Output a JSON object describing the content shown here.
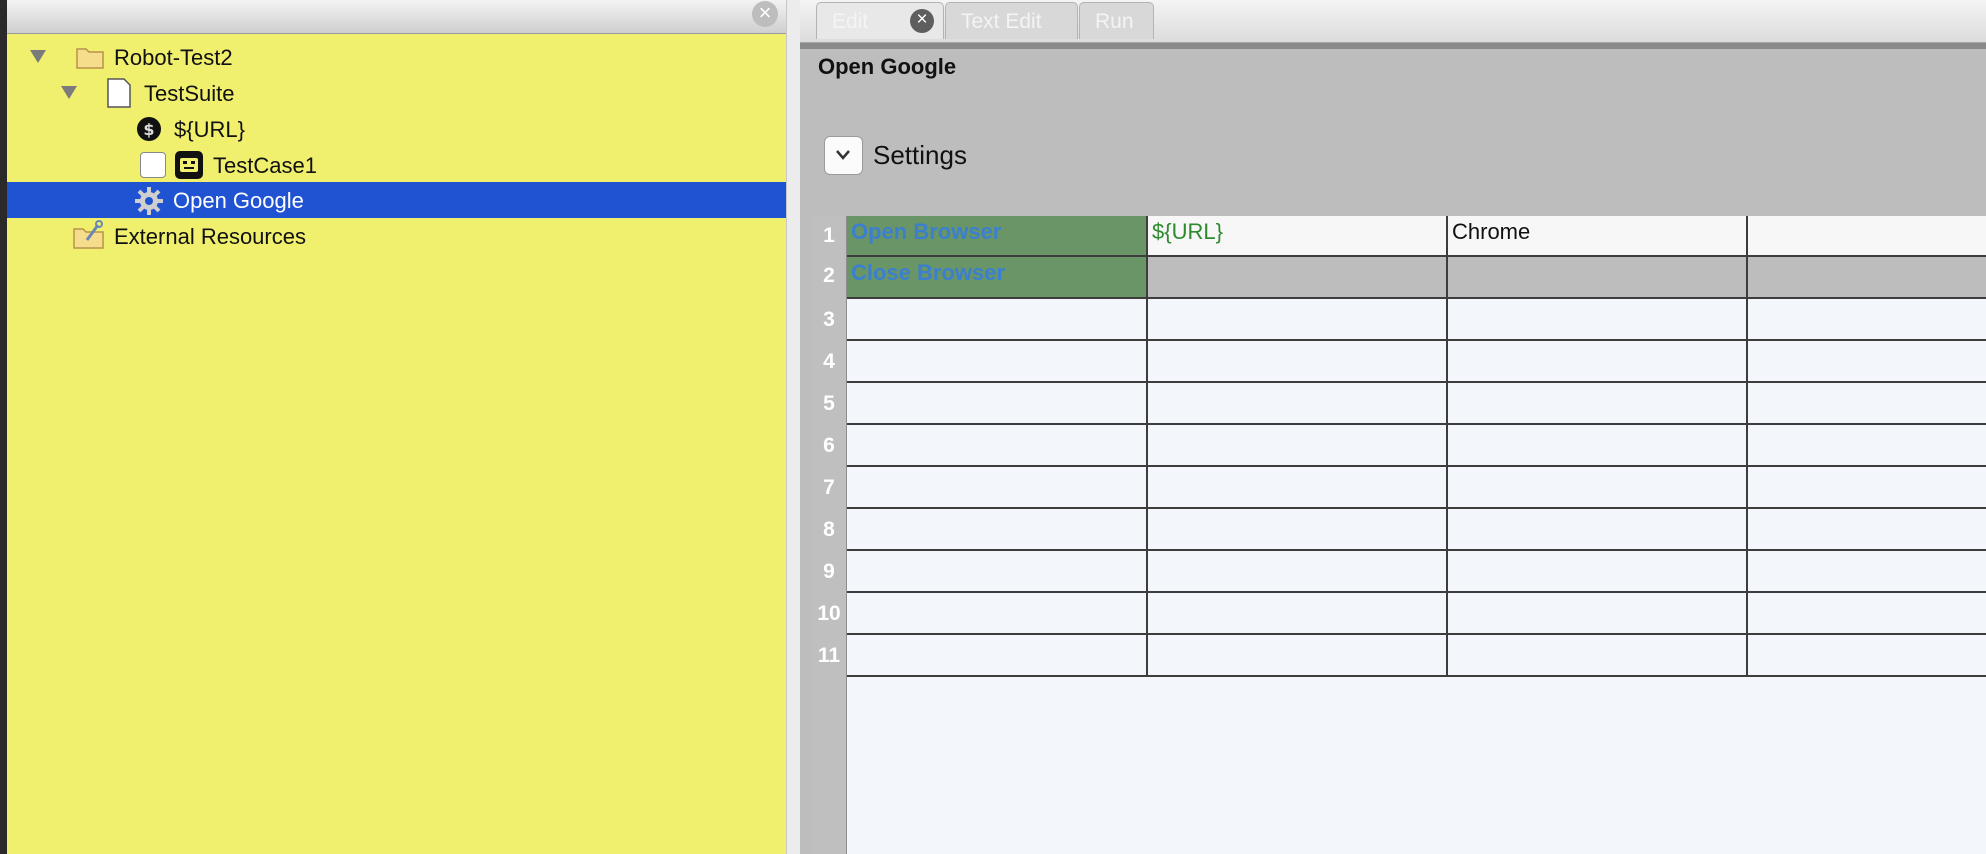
{
  "tree": {
    "items": [
      {
        "label": "Robot-Test2",
        "icon": "folder-icon"
      },
      {
        "label": "TestSuite",
        "icon": "file-icon"
      },
      {
        "label": "${URL}",
        "icon": "variable-icon"
      },
      {
        "label": "TestCase1",
        "icon": "robot-icon"
      },
      {
        "label": "Open Google",
        "icon": "gear-icon"
      },
      {
        "label": "External Resources",
        "icon": "resource-folder-icon"
      }
    ],
    "selected": "Open Google"
  },
  "tabs": [
    {
      "label": "Edit"
    },
    {
      "label": "Text Edit"
    },
    {
      "label": "Run"
    }
  ],
  "editor": {
    "title": "Open Google",
    "settings_label": "Settings"
  },
  "grid": {
    "row_numbers": [
      "1",
      "2",
      "3",
      "4",
      "5",
      "6",
      "7",
      "8",
      "9",
      "10",
      "11"
    ],
    "rows": [
      [
        "Open Browser",
        "${URL}",
        "Chrome",
        ""
      ],
      [
        "Close Browser",
        "",
        "",
        ""
      ]
    ]
  },
  "colors": {
    "tree_bg": "#f0ef6e",
    "selection": "#1f53d1",
    "keyword_cell": "#6a9566",
    "keyword_text": "#3b7fcf",
    "variable_text": "#2d8a2d"
  }
}
